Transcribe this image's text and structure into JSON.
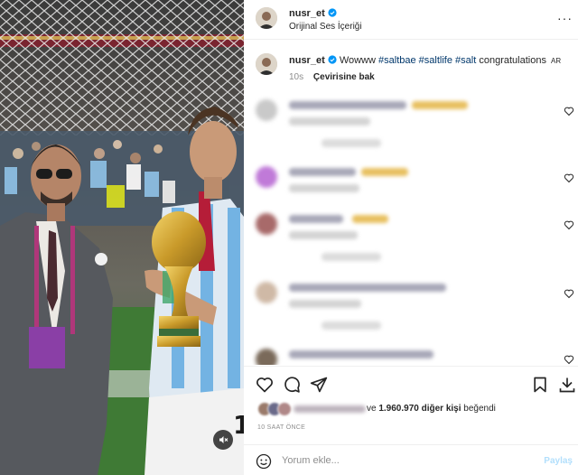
{
  "post": {
    "username": "nusr_et",
    "audio_label": "Orijinal Ses İçeriği",
    "more_label": "···"
  },
  "caption": {
    "username": "nusr_et",
    "hashtags": [
      "#saltbae",
      "#saltlife",
      "#salt"
    ],
    "lead_text": "Wowww",
    "trail_text": "congratulations",
    "flag_badge": "AR",
    "time": "10s",
    "translate_label": "Çevirisine bak"
  },
  "likes": {
    "connector": "ve",
    "count_text": "1.960.970 diğer kişi",
    "verb": "beğendi"
  },
  "time_ago": "10 SAAT ÖNCE",
  "composer": {
    "placeholder": "Yorum ekle...",
    "share_label": "Paylaş"
  },
  "icons": {
    "verified": "verified-badge-icon",
    "heart": "heart-icon",
    "comment": "comment-icon",
    "share": "send-icon",
    "save": "bookmark-icon",
    "download": "download-icon",
    "emoji": "emoji-icon",
    "mute": "speaker-muted-icon",
    "more": "more-options-icon"
  },
  "colors": {
    "verified_blue": "#0095f6",
    "hashtag_link": "#00376b",
    "muted_text": "#8e8e8e",
    "share_disabled": "#b2dffc"
  }
}
